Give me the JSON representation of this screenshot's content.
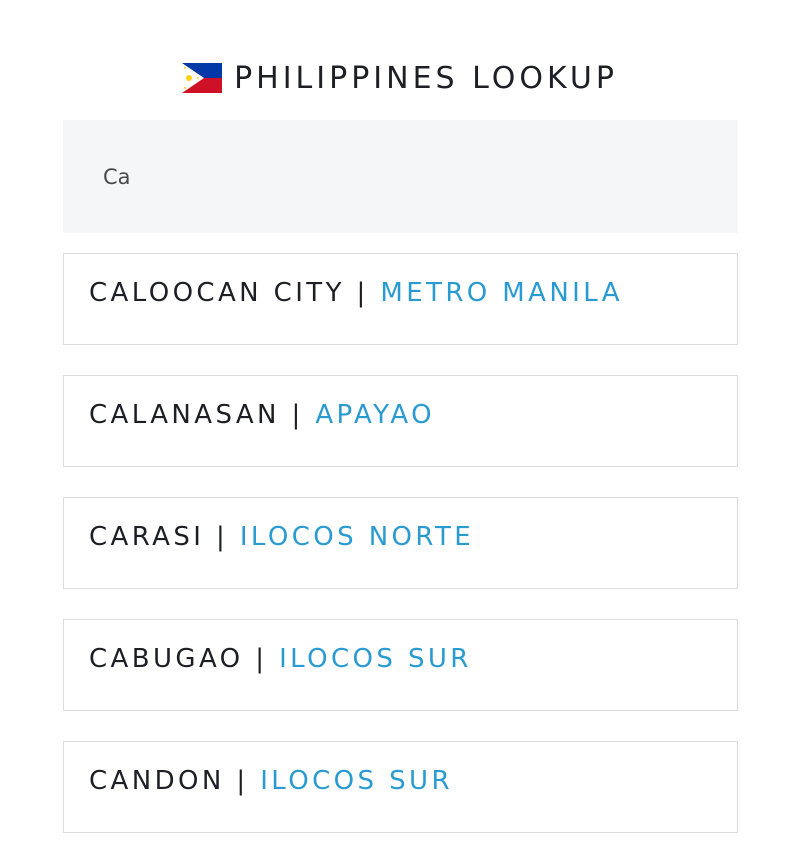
{
  "header": {
    "flag_icon": "philippines-flag-icon",
    "title": "PHILIPPINES LOOKUP"
  },
  "search": {
    "value": "Ca",
    "placeholder": ""
  },
  "separator": "|",
  "results": [
    {
      "city": "CALOOCAN CITY",
      "province": "METRO MANILA"
    },
    {
      "city": "CALANASAN",
      "province": "APAYAO"
    },
    {
      "city": "CARASI",
      "province": "ILOCOS NORTE"
    },
    {
      "city": "CABUGAO",
      "province": "ILOCOS SUR"
    },
    {
      "city": "CANDON",
      "province": "ILOCOS SUR"
    }
  ],
  "colors": {
    "accent": "#2a9bd1",
    "text": "#1d1f24",
    "search_bg": "#f5f6f8",
    "border": "#dcdcdc"
  }
}
